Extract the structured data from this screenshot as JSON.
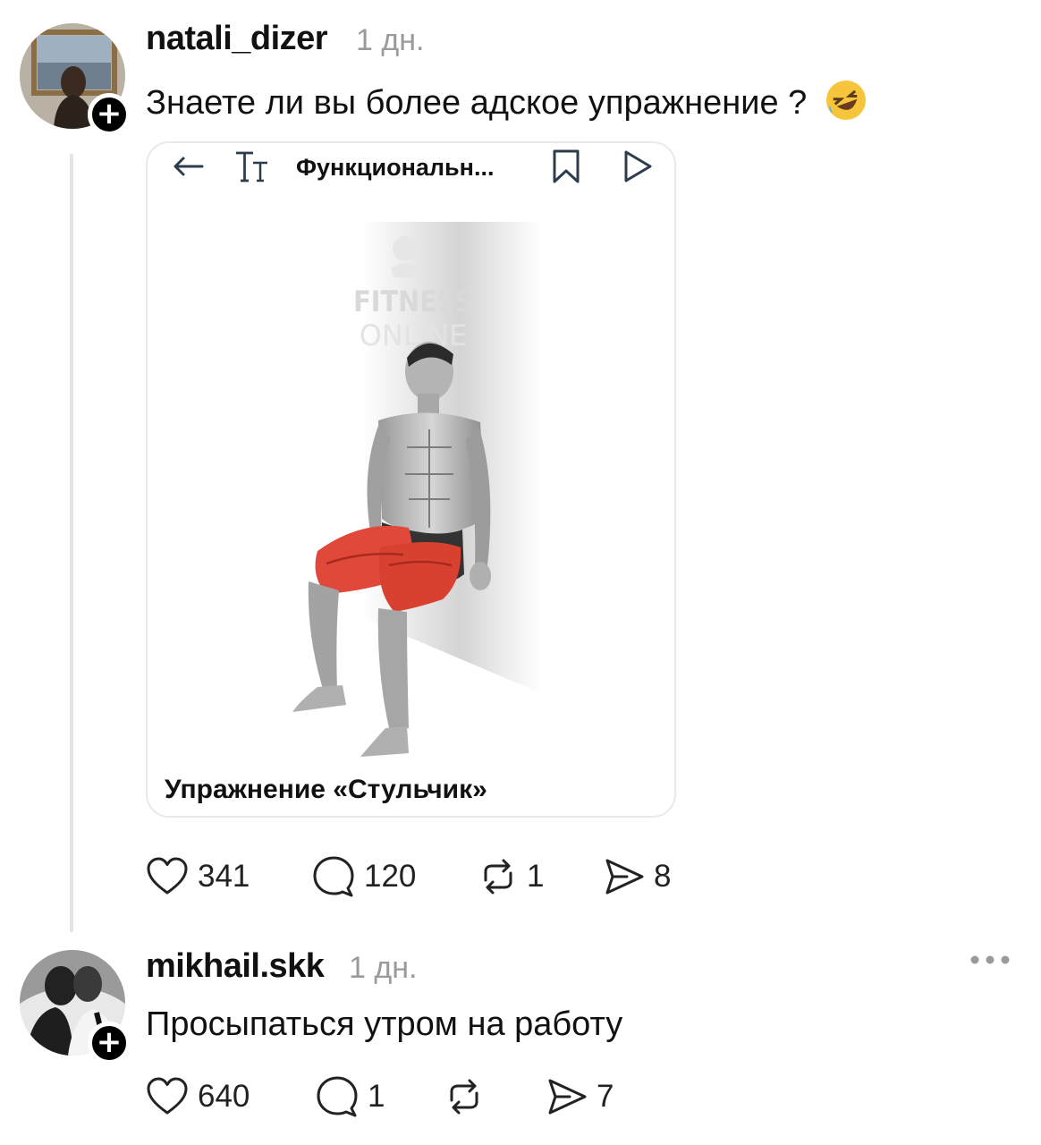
{
  "post": {
    "username": "natali_dizer",
    "time": "1 дн.",
    "text": "Знаете ли вы более адское упражнение ?",
    "emoji": "🤣",
    "link_card": {
      "title": "Функциональн...",
      "watermark_line1": "FITNESS",
      "watermark_line2": "ONLINE",
      "caption": "Упражнение «Стульчик»",
      "toolbar_icons": [
        "back-arrow-icon",
        "text-size-icon",
        "bookmark-icon",
        "play-icon"
      ]
    },
    "actions": {
      "likes": "341",
      "comments": "120",
      "reposts": "1",
      "shares": "8"
    }
  },
  "reply": {
    "username": "mikhail.skk",
    "time": "1 дн.",
    "text": "Просыпаться утром на работу",
    "actions": {
      "likes": "640",
      "comments": "1",
      "reposts": "",
      "shares": "7"
    }
  },
  "icons": {
    "like": "heart-icon",
    "comment": "comment-bubble-icon",
    "repost": "repost-icon",
    "share": "send-icon",
    "more": "more-dots-icon",
    "follow": "plus-icon"
  },
  "colors": {
    "text": "#111111",
    "muted": "#9a9a9a",
    "muscle_highlight": "#e0483a"
  }
}
